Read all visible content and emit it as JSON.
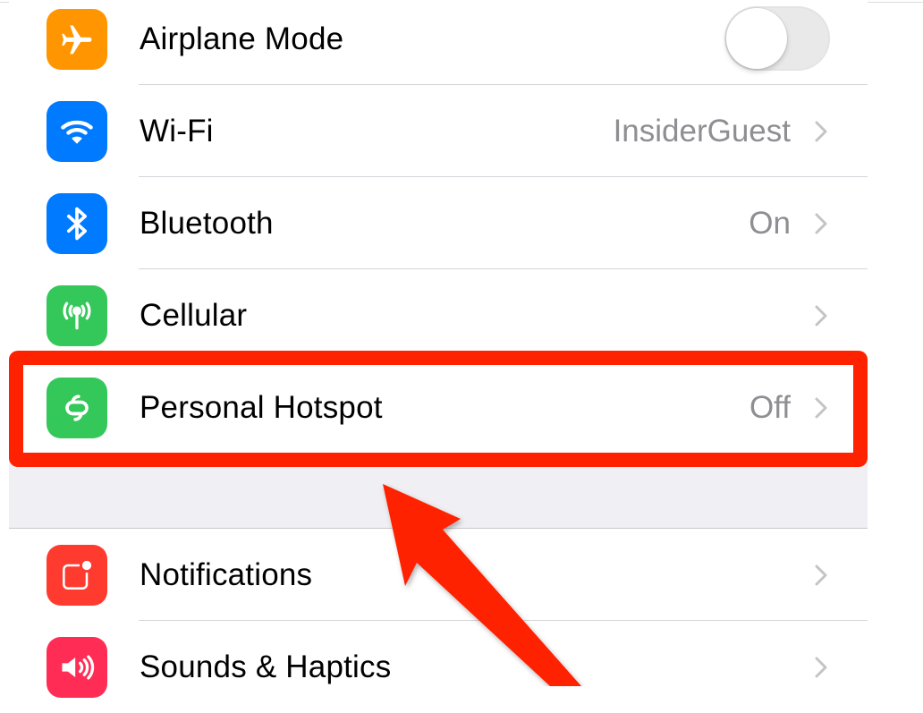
{
  "settings": {
    "group1": [
      {
        "label": "Airplane Mode",
        "icon": "airplane-icon",
        "icon_color": "#ff9500",
        "accessory": "toggle",
        "toggle_on": false
      },
      {
        "label": "Wi-Fi",
        "icon": "wifi-icon",
        "icon_color": "#007aff",
        "value": "InsiderGuest",
        "accessory": "chevron"
      },
      {
        "label": "Bluetooth",
        "icon": "bluetooth-icon",
        "icon_color": "#007aff",
        "value": "On",
        "accessory": "chevron"
      },
      {
        "label": "Cellular",
        "icon": "cellular-antenna-icon",
        "icon_color": "#34c759",
        "value": "",
        "accessory": "chevron"
      },
      {
        "label": "Personal Hotspot",
        "icon": "hotspot-link-icon",
        "icon_color": "#34c759",
        "value": "Off",
        "accessory": "chevron",
        "highlighted": true
      }
    ],
    "group2": [
      {
        "label": "Notifications",
        "icon": "notifications-icon",
        "icon_color": "#ff3b30",
        "value": "",
        "accessory": "chevron"
      },
      {
        "label": "Sounds & Haptics",
        "icon": "speaker-icon",
        "icon_color": "#ff2d55",
        "value": "",
        "accessory": "chevron"
      }
    ]
  },
  "annotation": {
    "highlight_color": "#ff2200",
    "highlight_target": "Personal Hotspot",
    "arrow_color": "#ff2200"
  }
}
